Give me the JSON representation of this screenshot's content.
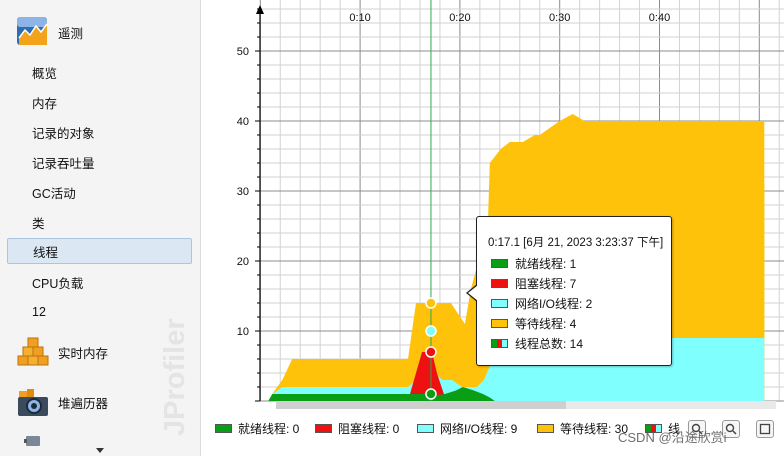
{
  "sidebar": {
    "section_telemetry": "遥测",
    "items": [
      {
        "label": "概览"
      },
      {
        "label": "内存"
      },
      {
        "label": "记录的对象"
      },
      {
        "label": "记录吞吐量"
      },
      {
        "label": "GC活动"
      },
      {
        "label": "类"
      },
      {
        "label": "线程"
      },
      {
        "label": "CPU负载"
      },
      {
        "label": "12"
      }
    ],
    "section_live_memory": "实时内存",
    "section_heap_walker": "堆遍历器",
    "watermark": "JProfiler",
    "selected_index": 6
  },
  "chart": {
    "y_ticks": [
      "10",
      "20",
      "30",
      "40",
      "50"
    ],
    "x_ticks": [
      "0:10",
      "0:20",
      "0:30",
      "0:40"
    ]
  },
  "chart_data": {
    "type": "area",
    "x_unit": "seconds",
    "xlim": [
      0,
      51
    ],
    "ylim": [
      0,
      57
    ],
    "x_ticks": [
      "0:10",
      "0:20",
      "0:30",
      "0:40"
    ],
    "y_ticks": [
      10,
      20,
      30,
      40,
      50
    ],
    "grid": true,
    "legend_position": "bottom",
    "series": [
      {
        "name": "就绪线程",
        "color": "#0a9e17",
        "points": [
          [
            0.8,
            0
          ],
          [
            1.2,
            1
          ],
          [
            16.3,
            1
          ],
          [
            16.9,
            1.5
          ],
          [
            17.1,
            1
          ],
          [
            17.6,
            0.8
          ],
          [
            18.5,
            1
          ],
          [
            19.6,
            1.5
          ],
          [
            20.3,
            2
          ],
          [
            21.4,
            1.5
          ],
          [
            22.3,
            1
          ],
          [
            23,
            0.5
          ],
          [
            23.5,
            0
          ],
          [
            50.5,
            0
          ]
        ]
      },
      {
        "name": "阻塞线程",
        "color": "#ee1111",
        "points": [
          [
            0.8,
            0
          ],
          [
            14.8,
            0
          ],
          [
            15.6,
            4
          ],
          [
            16.2,
            7
          ],
          [
            16.7,
            7
          ],
          [
            17.2,
            7
          ],
          [
            17.7,
            4
          ],
          [
            18.4,
            1
          ],
          [
            19,
            0
          ],
          [
            50.5,
            0
          ]
        ]
      },
      {
        "name": "网络I/O线程",
        "color": "#80ffff",
        "points": [
          [
            0.8,
            0
          ],
          [
            1.2,
            1
          ],
          [
            2.2,
            2
          ],
          [
            14.8,
            2
          ],
          [
            15.6,
            3
          ],
          [
            16.7,
            6
          ],
          [
            17.4,
            4
          ],
          [
            18.3,
            3
          ],
          [
            19.2,
            3
          ],
          [
            20.2,
            2
          ],
          [
            21.7,
            2
          ],
          [
            22.4,
            3
          ],
          [
            23,
            5
          ],
          [
            24,
            6
          ],
          [
            24.7,
            7
          ],
          [
            25.2,
            8
          ],
          [
            26,
            9
          ],
          [
            50.5,
            9
          ]
        ]
      },
      {
        "name": "等待线程",
        "color": "#ffc20a",
        "points": [
          [
            0.8,
            0
          ],
          [
            1.2,
            1
          ],
          [
            2.2,
            3
          ],
          [
            3.2,
            5
          ],
          [
            14.8,
            4
          ],
          [
            15.4,
            10
          ],
          [
            16.3,
            6
          ],
          [
            17.1,
            4
          ],
          [
            18.1,
            2
          ],
          [
            19.6,
            1
          ],
          [
            21.1,
            3
          ],
          [
            22.8,
            16
          ],
          [
            23,
            22
          ],
          [
            24.1,
            26
          ],
          [
            25,
            27
          ],
          [
            26.3,
            26
          ],
          [
            27.5,
            27
          ],
          [
            28,
            28
          ],
          [
            30,
            30
          ],
          [
            31.3,
            31
          ],
          [
            32.5,
            31
          ],
          [
            33.7,
            30
          ],
          [
            36,
            31
          ],
          [
            50.5,
            31
          ]
        ]
      },
      {
        "name": "线程总数",
        "color": "#ffc20a",
        "points": [
          [
            0.8,
            0
          ],
          [
            1.2,
            1
          ],
          [
            2.2,
            3
          ],
          [
            3.2,
            6
          ],
          [
            14.8,
            6
          ],
          [
            15.6,
            14
          ],
          [
            16.3,
            14
          ],
          [
            16.7,
            14
          ],
          [
            17.4,
            14
          ],
          [
            18.1,
            14
          ],
          [
            19.1,
            14
          ],
          [
            20.5,
            11
          ],
          [
            21.1,
            16
          ],
          [
            22.8,
            25
          ],
          [
            23,
            34
          ],
          [
            24.1,
            36
          ],
          [
            25,
            37
          ],
          [
            26.3,
            37
          ],
          [
            27.5,
            38
          ],
          [
            28,
            38
          ],
          [
            30,
            40
          ],
          [
            31.3,
            41
          ],
          [
            32.5,
            40
          ],
          [
            33.7,
            40
          ],
          [
            50.5,
            40
          ]
        ]
      }
    ],
    "cursor": {
      "time": "0:17.1",
      "values": {
        "就绪线程": 1,
        "阻塞线程": 7,
        "网络I/O线程": 2,
        "等待线程": 4,
        "线程总数": 14
      }
    }
  },
  "tooltip": {
    "title": "0:17.1 [6月 21, 2023 3:23:37 下午]",
    "rows": [
      {
        "label": "就绪线程:  1",
        "color": "#0a9e17"
      },
      {
        "label": "阻塞线程:  7",
        "color": "#ee1111"
      },
      {
        "label": "网络I/O线程:  2",
        "color": "#80ffff"
      },
      {
        "label": "等待线程:  4",
        "color": "#ffc20a"
      },
      {
        "label": "线程总数:  14",
        "color": "multi"
      }
    ]
  },
  "legend": {
    "items": [
      {
        "label": "就绪线程: 0",
        "color": "#0a9e17"
      },
      {
        "label": "阻塞线程: 0",
        "color": "#ee1111"
      },
      {
        "label": "网络I/O线程: 9",
        "color": "#80ffff"
      },
      {
        "label": "等待线程: 30",
        "color": "#ffc20a"
      },
      {
        "label": "线",
        "color": "multi"
      }
    ]
  },
  "footer": {
    "csdn_watermark": "CSDN @沿途欣赏i"
  }
}
